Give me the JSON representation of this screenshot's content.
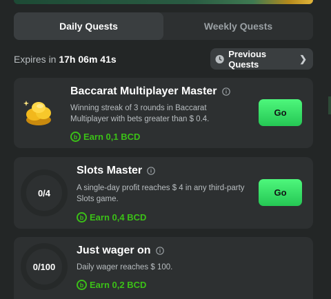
{
  "tabs": [
    {
      "label": "Daily Quests",
      "active": true
    },
    {
      "label": "Weekly Quests",
      "active": false
    }
  ],
  "expires": {
    "prefix": "Expires in",
    "time": "17h 06m 41s"
  },
  "previous_quests": {
    "label": "Previous Quests",
    "icon": "clock-icon"
  },
  "quests": [
    {
      "title": "Baccarat Multiplayer Master",
      "description": "Winning streak of 3 rounds in Baccarat Multiplayer with bets greater than $ 0.4.",
      "reward": "Earn 0,1 BCD",
      "button": "Go",
      "icon": "gold-coins-icon"
    },
    {
      "title": "Slots Master",
      "description": "A single-day profit reaches $ 4 in any third-party Slots game.",
      "reward": "Earn 0,4 BCD",
      "button": "Go",
      "progress": "0/4"
    },
    {
      "title": "Just wager on",
      "description": "Daily wager reaches $ 100.",
      "reward": "Earn 0,2 BCD",
      "progress": "0/100"
    }
  ],
  "colors": {
    "accent": "#3bc117",
    "button": "#2fd860",
    "card": "#2d3031",
    "background": "#232626"
  }
}
